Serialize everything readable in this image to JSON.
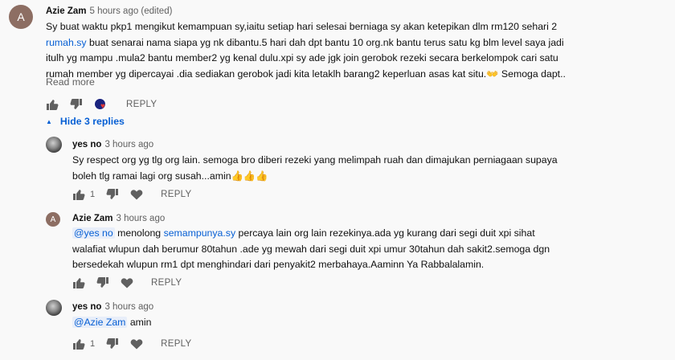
{
  "comment": {
    "avatar_letter": "A",
    "author": "Azie Zam",
    "time": "5 hours ago (edited)",
    "line1": "Sy buat waktu pkp1  mengikut kemampuan sy,iaitu setiap hari selesai berniaga sy akan ketepikan dlm rm120 sehari 2",
    "line2_link": "rumah.sy",
    "line2_rest": " buat senarai nama siapa yg nk dibantu.5 hari dah dpt bantu 10 org.nk bantu terus satu kg blm level saya jadi",
    "line3": "itulh yg mampu .mula2 bantu member2 yg kenal dulu.xpi sy ade jgk join gerobok rezeki secara berkelompok cari satu",
    "line4": "rumah member yg dipercayai .dia sediakan gerobok jadi kita letaklh barang2 keperluan asas kat situ.👐  Semoga dapt..",
    "read_more": "Read more",
    "reply_label": "REPLY"
  },
  "hide_replies": "Hide 3 replies",
  "replies": [
    {
      "author": "yes no",
      "time": "3 hours ago",
      "line1": "Sy respect org yg tlg org lain. semoga bro diberi rezeki yang melimpah ruah dan dimajukan perniagaan supaya",
      "line2": "boleh tlg ramai lagi org susah...amin👍👍👍",
      "likes": "1",
      "reply_label": "REPLY"
    },
    {
      "avatar_letter": "A",
      "author": "Azie Zam",
      "time": "3 hours ago",
      "mention": "@yes no",
      "line1_mid": "  menolong ",
      "line1_link": "semampunya.sy",
      "line1_rest": " percaya lain org lain rezekinya.ada yg kurang dari segi duit xpi sihat",
      "line2": "walafiat wlupun dah berumur 80tahun .ade yg mewah dari segi duit xpi umur 30tahun dah sakit2.semoga dgn",
      "line3": "bersedekah wlupun rm1 dpt menghindari dari penyakit2 merbahaya.Aaminn Ya Rabbalalamin.",
      "reply_label": "REPLY"
    },
    {
      "author": "yes no",
      "time": "3 hours ago",
      "mention": "@Azie Zam",
      "text": "  amin",
      "likes": "1",
      "reply_label": "REPLY"
    }
  ]
}
